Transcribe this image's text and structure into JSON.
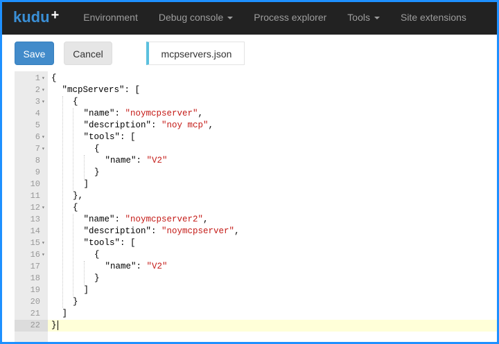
{
  "brand": {
    "name": "kudu",
    "plus": "+"
  },
  "nav": {
    "items": [
      {
        "label": "Environment",
        "dropdown": false
      },
      {
        "label": "Debug console",
        "dropdown": true
      },
      {
        "label": "Process explorer",
        "dropdown": false
      },
      {
        "label": "Tools",
        "dropdown": true
      },
      {
        "label": "Site extensions",
        "dropdown": false
      }
    ]
  },
  "toolbar": {
    "save_label": "Save",
    "cancel_label": "Cancel",
    "file_name": "mcpservers.json"
  },
  "editor": {
    "active_line": 22,
    "lines": [
      {
        "n": "1",
        "fold": true,
        "indent": 0,
        "tokens": [
          [
            "p",
            "{"
          ]
        ]
      },
      {
        "n": "2",
        "fold": true,
        "indent": 1,
        "tokens": [
          [
            "p",
            "\"mcpServers\": ["
          ]
        ]
      },
      {
        "n": "3",
        "fold": true,
        "indent": 2,
        "tokens": [
          [
            "p",
            "{"
          ]
        ]
      },
      {
        "n": "4",
        "fold": false,
        "indent": 3,
        "tokens": [
          [
            "p",
            "\"name\": "
          ],
          [
            "s",
            "\"noymcpserver\""
          ],
          [
            "p",
            ","
          ]
        ]
      },
      {
        "n": "5",
        "fold": false,
        "indent": 3,
        "tokens": [
          [
            "p",
            "\"description\": "
          ],
          [
            "s",
            "\"noy mcp\""
          ],
          [
            "p",
            ","
          ]
        ]
      },
      {
        "n": "6",
        "fold": true,
        "indent": 3,
        "tokens": [
          [
            "p",
            "\"tools\": ["
          ]
        ]
      },
      {
        "n": "7",
        "fold": true,
        "indent": 4,
        "tokens": [
          [
            "p",
            "{"
          ]
        ]
      },
      {
        "n": "8",
        "fold": false,
        "indent": 5,
        "tokens": [
          [
            "p",
            "\"name\": "
          ],
          [
            "s",
            "\"V2\""
          ]
        ]
      },
      {
        "n": "9",
        "fold": false,
        "indent": 4,
        "tokens": [
          [
            "p",
            "}"
          ]
        ]
      },
      {
        "n": "10",
        "fold": false,
        "indent": 3,
        "tokens": [
          [
            "p",
            "]"
          ]
        ]
      },
      {
        "n": "11",
        "fold": false,
        "indent": 2,
        "tokens": [
          [
            "p",
            "},"
          ]
        ]
      },
      {
        "n": "12",
        "fold": true,
        "indent": 2,
        "tokens": [
          [
            "p",
            "{"
          ]
        ]
      },
      {
        "n": "13",
        "fold": false,
        "indent": 3,
        "tokens": [
          [
            "p",
            "\"name\": "
          ],
          [
            "s",
            "\"noymcpserver2\""
          ],
          [
            "p",
            ","
          ]
        ]
      },
      {
        "n": "14",
        "fold": false,
        "indent": 3,
        "tokens": [
          [
            "p",
            "\"description\": "
          ],
          [
            "s",
            "\"noymcpserver\""
          ],
          [
            "p",
            ","
          ]
        ]
      },
      {
        "n": "15",
        "fold": true,
        "indent": 3,
        "tokens": [
          [
            "p",
            "\"tools\": ["
          ]
        ]
      },
      {
        "n": "16",
        "fold": true,
        "indent": 4,
        "tokens": [
          [
            "p",
            "{"
          ]
        ]
      },
      {
        "n": "17",
        "fold": false,
        "indent": 5,
        "tokens": [
          [
            "p",
            "\"name\": "
          ],
          [
            "s",
            "\"V2\""
          ]
        ]
      },
      {
        "n": "18",
        "fold": false,
        "indent": 4,
        "tokens": [
          [
            "p",
            "}"
          ]
        ]
      },
      {
        "n": "19",
        "fold": false,
        "indent": 3,
        "tokens": [
          [
            "p",
            "]"
          ]
        ]
      },
      {
        "n": "20",
        "fold": false,
        "indent": 2,
        "tokens": [
          [
            "p",
            "}"
          ]
        ]
      },
      {
        "n": "21",
        "fold": false,
        "indent": 1,
        "tokens": [
          [
            "p",
            "]"
          ]
        ]
      },
      {
        "n": "22",
        "fold": false,
        "indent": 0,
        "tokens": [
          [
            "p",
            "}"
          ]
        ]
      }
    ]
  },
  "colors": {
    "navbar": "#222222",
    "nav_text": "#9d9d9d",
    "accent": "#428bca",
    "string": "#c41a16",
    "active_line": "#ffffd8",
    "frame": "#1e90ff",
    "tab_accent": "#5bc0de"
  }
}
